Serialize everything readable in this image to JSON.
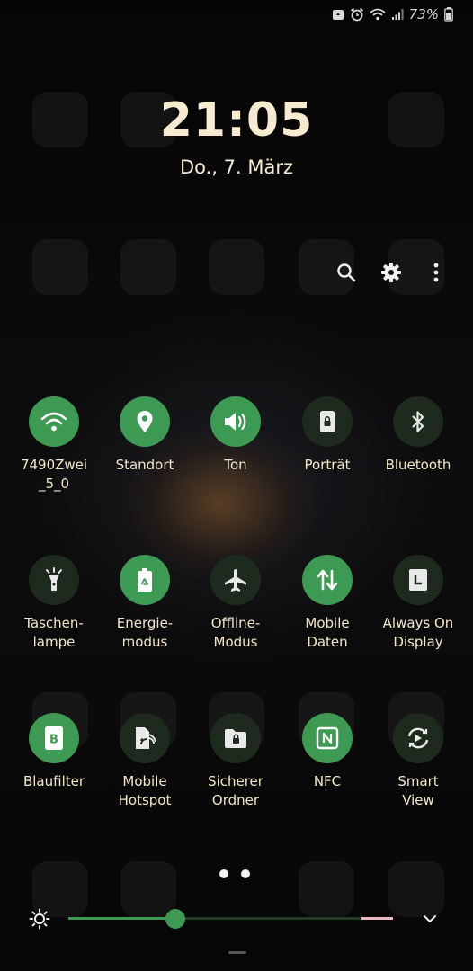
{
  "status_bar": {
    "battery_percent": "73%"
  },
  "lock": {
    "time": "21:05",
    "date": "Do., 7. März"
  },
  "header": {
    "icons": [
      "search-icon",
      "gear-icon",
      "more-vert-icon"
    ]
  },
  "tiles": [
    {
      "label": "7490Zwei\n_5_0",
      "icon": "wifi-icon",
      "on": true
    },
    {
      "label": "Standort",
      "icon": "location-icon",
      "on": true
    },
    {
      "label": "Ton",
      "icon": "volume-icon",
      "on": true
    },
    {
      "label": "Porträt",
      "icon": "rotation-lock-icon",
      "on": false
    },
    {
      "label": "Bluetooth",
      "icon": "bluetooth-icon",
      "on": false
    },
    {
      "label": "Taschen-\nlampe",
      "icon": "flashlight-icon",
      "on": false
    },
    {
      "label": "Energie-\nmodus",
      "icon": "battery-recycle-icon",
      "on": true
    },
    {
      "label": "Offline-\nModus",
      "icon": "airplane-icon",
      "on": false
    },
    {
      "label": "Mobile\nDaten",
      "icon": "data-arrows-icon",
      "on": true
    },
    {
      "label": "Always On\nDisplay",
      "icon": "clock-square-icon",
      "on": false
    },
    {
      "label": "Blaufilter",
      "icon": "blue-light-filter-icon",
      "on": true
    },
    {
      "label": "Mobile\nHotspot",
      "icon": "hotspot-icon",
      "on": false
    },
    {
      "label": "Sicherer\nOrdner",
      "icon": "secure-folder-icon",
      "on": false
    },
    {
      "label": "NFC",
      "icon": "nfc-icon",
      "on": true
    },
    {
      "label": "Smart\nView",
      "icon": "smart-view-icon",
      "on": false
    }
  ],
  "pager": {
    "pages": 2,
    "current": 1
  },
  "brightness": {
    "level": 0.33
  },
  "colors": {
    "accent": "#3d9a52",
    "tile_off": "#1d2a1d",
    "text": "#f3e7c9"
  }
}
